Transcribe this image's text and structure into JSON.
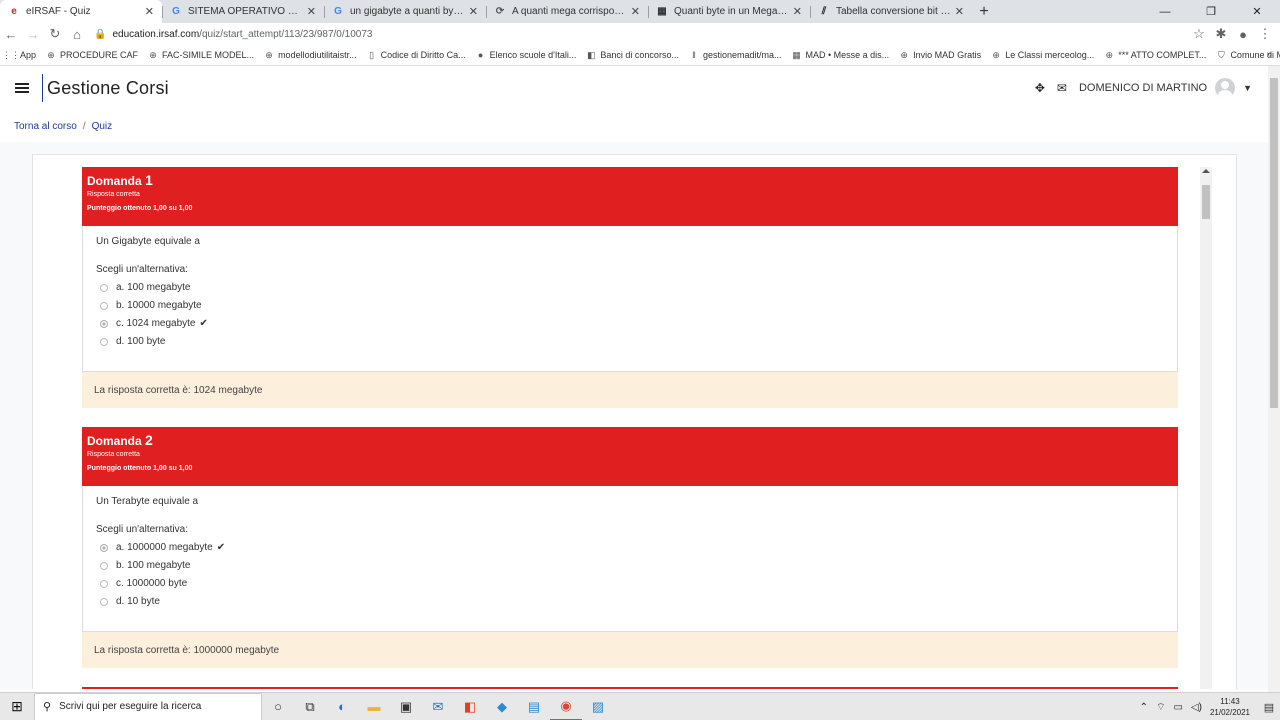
{
  "browser": {
    "tabs": [
      {
        "favicon": "e",
        "favicon_color": "#d21f2a",
        "title": "eIRSAF - Quiz",
        "active": true
      },
      {
        "favicon": "G",
        "favicon_color": "#4285f4",
        "title": "SITEMA OPERATIVO OPEN SOUR",
        "active": false
      },
      {
        "favicon": "G",
        "favicon_color": "#4285f4",
        "title": "un gigabyte a quanti byte corrisp",
        "active": false
      },
      {
        "favicon": "⟳",
        "favicon_color": "#555555",
        "title": "A quanti mega corrisponde un G",
        "active": false
      },
      {
        "favicon": "▦",
        "favicon_color": "#333333",
        "title": "Quanti byte in un Megabyte? e in",
        "active": false
      },
      {
        "favicon": "⫽",
        "favicon_color": "#222222",
        "title": "Tabella conversione bit | byte | K",
        "active": false
      }
    ],
    "url_host": "education.irsaf.com",
    "url_path": "/quiz/start_attempt/113/23/987/0/10073",
    "bookmarks": [
      {
        "icon": "app-grid-icon",
        "label": "App"
      },
      {
        "icon": "globe-icon",
        "label": "PROCEDURE CAF"
      },
      {
        "icon": "globe-icon",
        "label": "FAC-SIMILE MODEL..."
      },
      {
        "icon": "globe-icon",
        "label": "modellodiutilitaistr..."
      },
      {
        "icon": "book-icon",
        "label": "Codice di Diritto Ca..."
      },
      {
        "icon": "dot-icon",
        "label": "Elenco scuole d'Itali..."
      },
      {
        "icon": "ga-icon",
        "label": "Banci di concorso..."
      },
      {
        "icon": "bars-icon",
        "label": "gestionemadit/ma..."
      },
      {
        "icon": "mad-icon",
        "label": "MAD • Messe a dis..."
      },
      {
        "icon": "globe-icon",
        "label": "Invio MAD Gratis"
      },
      {
        "icon": "globe-icon",
        "label": "Le Classi merceolog..."
      },
      {
        "icon": "globe-icon",
        "label": "*** ATTO COMPLET..."
      },
      {
        "icon": "shield-icon",
        "label": "Comune di Melilli-C..."
      }
    ]
  },
  "app": {
    "brand": "Gestione Corsi",
    "username": "DOMENICO DI MARTINO",
    "breadcrumb": {
      "back": "Torna al corso",
      "current": "Quiz"
    }
  },
  "questions": [
    {
      "label": "Domanda",
      "number": "1",
      "status": "Risposta corretta",
      "score": "Punteggio ottenuto 1,00 su 1,00",
      "text": "Un Gigabyte equivale a",
      "prompt": "Scegli un'alternativa:",
      "answers": [
        {
          "text": "a. 100 megabyte",
          "checked": false,
          "correct": false
        },
        {
          "text": "b. 10000 megabyte",
          "checked": false,
          "correct": false
        },
        {
          "text": "c. 1024 megabyte",
          "checked": true,
          "correct": true
        },
        {
          "text": "d. 100 byte",
          "checked": false,
          "correct": false
        }
      ],
      "feedback": "La risposta corretta è: 1024 megabyte"
    },
    {
      "label": "Domanda",
      "number": "2",
      "status": "Risposta corretta",
      "score": "Punteggio ottenuto 1,00 su 1,00",
      "text": "Un Terabyte equivale a",
      "prompt": "Scegli un'alternativa:",
      "answers": [
        {
          "text": "a. 1000000 megabyte",
          "checked": true,
          "correct": true
        },
        {
          "text": "b. 100 megabyte",
          "checked": false,
          "correct": false
        },
        {
          "text": "c. 1000000 byte",
          "checked": false,
          "correct": false
        },
        {
          "text": "d. 10 byte",
          "checked": false,
          "correct": false
        }
      ],
      "feedback": "La risposta corretta è: 1000000 megabyte"
    }
  ],
  "taskbar": {
    "search_placeholder": "Scrivi qui per eseguire la ricerca",
    "time": "11:43",
    "date": "21/02/2021"
  },
  "colors": {
    "question_header": "#e02020",
    "feedback_bg": "#fcefdc",
    "link": "#1f3a93"
  }
}
